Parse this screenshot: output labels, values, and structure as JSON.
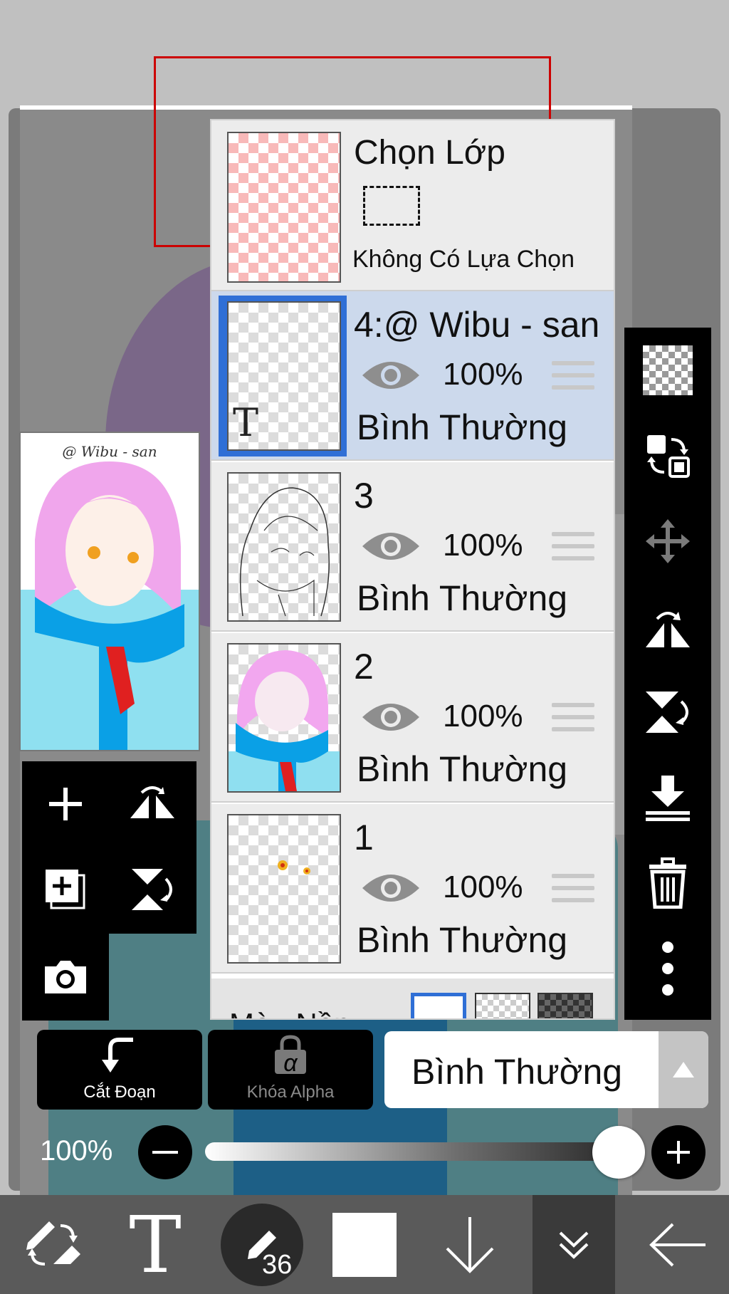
{
  "layer_panel": {
    "selection": {
      "title": "Chọn Lớp",
      "status": "Không Có Lựa Chọn"
    },
    "layers": [
      {
        "name": "4:@ Wibu - san",
        "opacity": "100%",
        "blend": "Bình Thường",
        "visible": true,
        "selected": true,
        "is_text": true
      },
      {
        "name": "3",
        "opacity": "100%",
        "blend": "Bình Thường",
        "visible": true,
        "selected": false
      },
      {
        "name": "2",
        "opacity": "100%",
        "blend": "Bình Thường",
        "visible": true,
        "selected": false
      },
      {
        "name": "1",
        "opacity": "100%",
        "blend": "Bình Thường",
        "visible": true,
        "selected": false
      }
    ],
    "background_label": "Màu Nền"
  },
  "preview": {
    "caption": "@ Wibu - san"
  },
  "buttons": {
    "clipping": "Cắt Đoạn",
    "alpha_lock": "Khóa Alpha",
    "alpha_symbol": "α"
  },
  "blend_mode": {
    "value": "Bình Thường"
  },
  "opacity": {
    "label": "100%",
    "value": 1.0
  },
  "bottom_toolbar": {
    "brush_size": "36",
    "text_tool_glyph": "T"
  },
  "colors": {
    "selected_layer_bg": "#ccd9ec",
    "selected_border": "#2f6fd6",
    "selection_rect": "#cc0000"
  }
}
